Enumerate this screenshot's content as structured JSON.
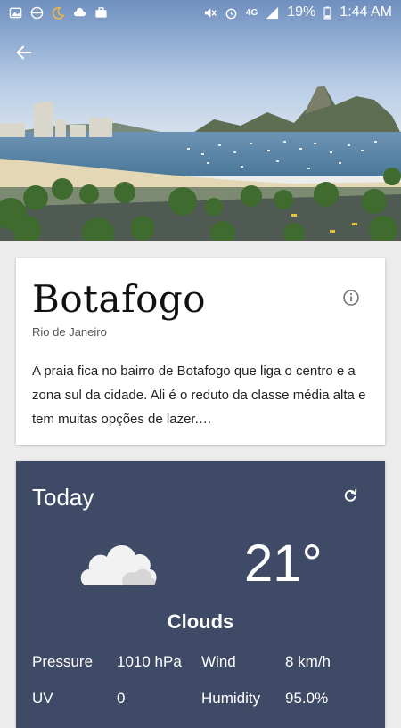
{
  "status_bar": {
    "battery": "19%",
    "time": "1:44 AM",
    "network": "4G",
    "icons_left": [
      "gallery-icon",
      "ball-icon",
      "moon-icon",
      "cloud-icon",
      "briefcase-icon"
    ],
    "icons_right": [
      "mute-icon",
      "alarm-icon",
      "signal-icon",
      "battery-icon"
    ]
  },
  "header": {
    "back_icon": "arrow-left-icon"
  },
  "place": {
    "title": "Botafogo",
    "subtitle": "Rio de Janeiro",
    "description": "A praia fica no bairro de Botafogo que liga o centro e a zona sul da cidade. Ali é o reduto da classe média alta e tem muitas opções de lazer.…"
  },
  "weather": {
    "title": "Today",
    "temperature": "21°",
    "condition": "Clouds",
    "rows": [
      {
        "left_label": "Pressure",
        "left_value": "1010 hPa",
        "right_label": "Wind",
        "right_value": "8 km/h"
      },
      {
        "left_label": "UV",
        "left_value": "0",
        "right_label": "Humidity",
        "right_value": "95.0%"
      }
    ]
  },
  "colors": {
    "weather_card": "#3f4a66",
    "background": "#ececec"
  }
}
